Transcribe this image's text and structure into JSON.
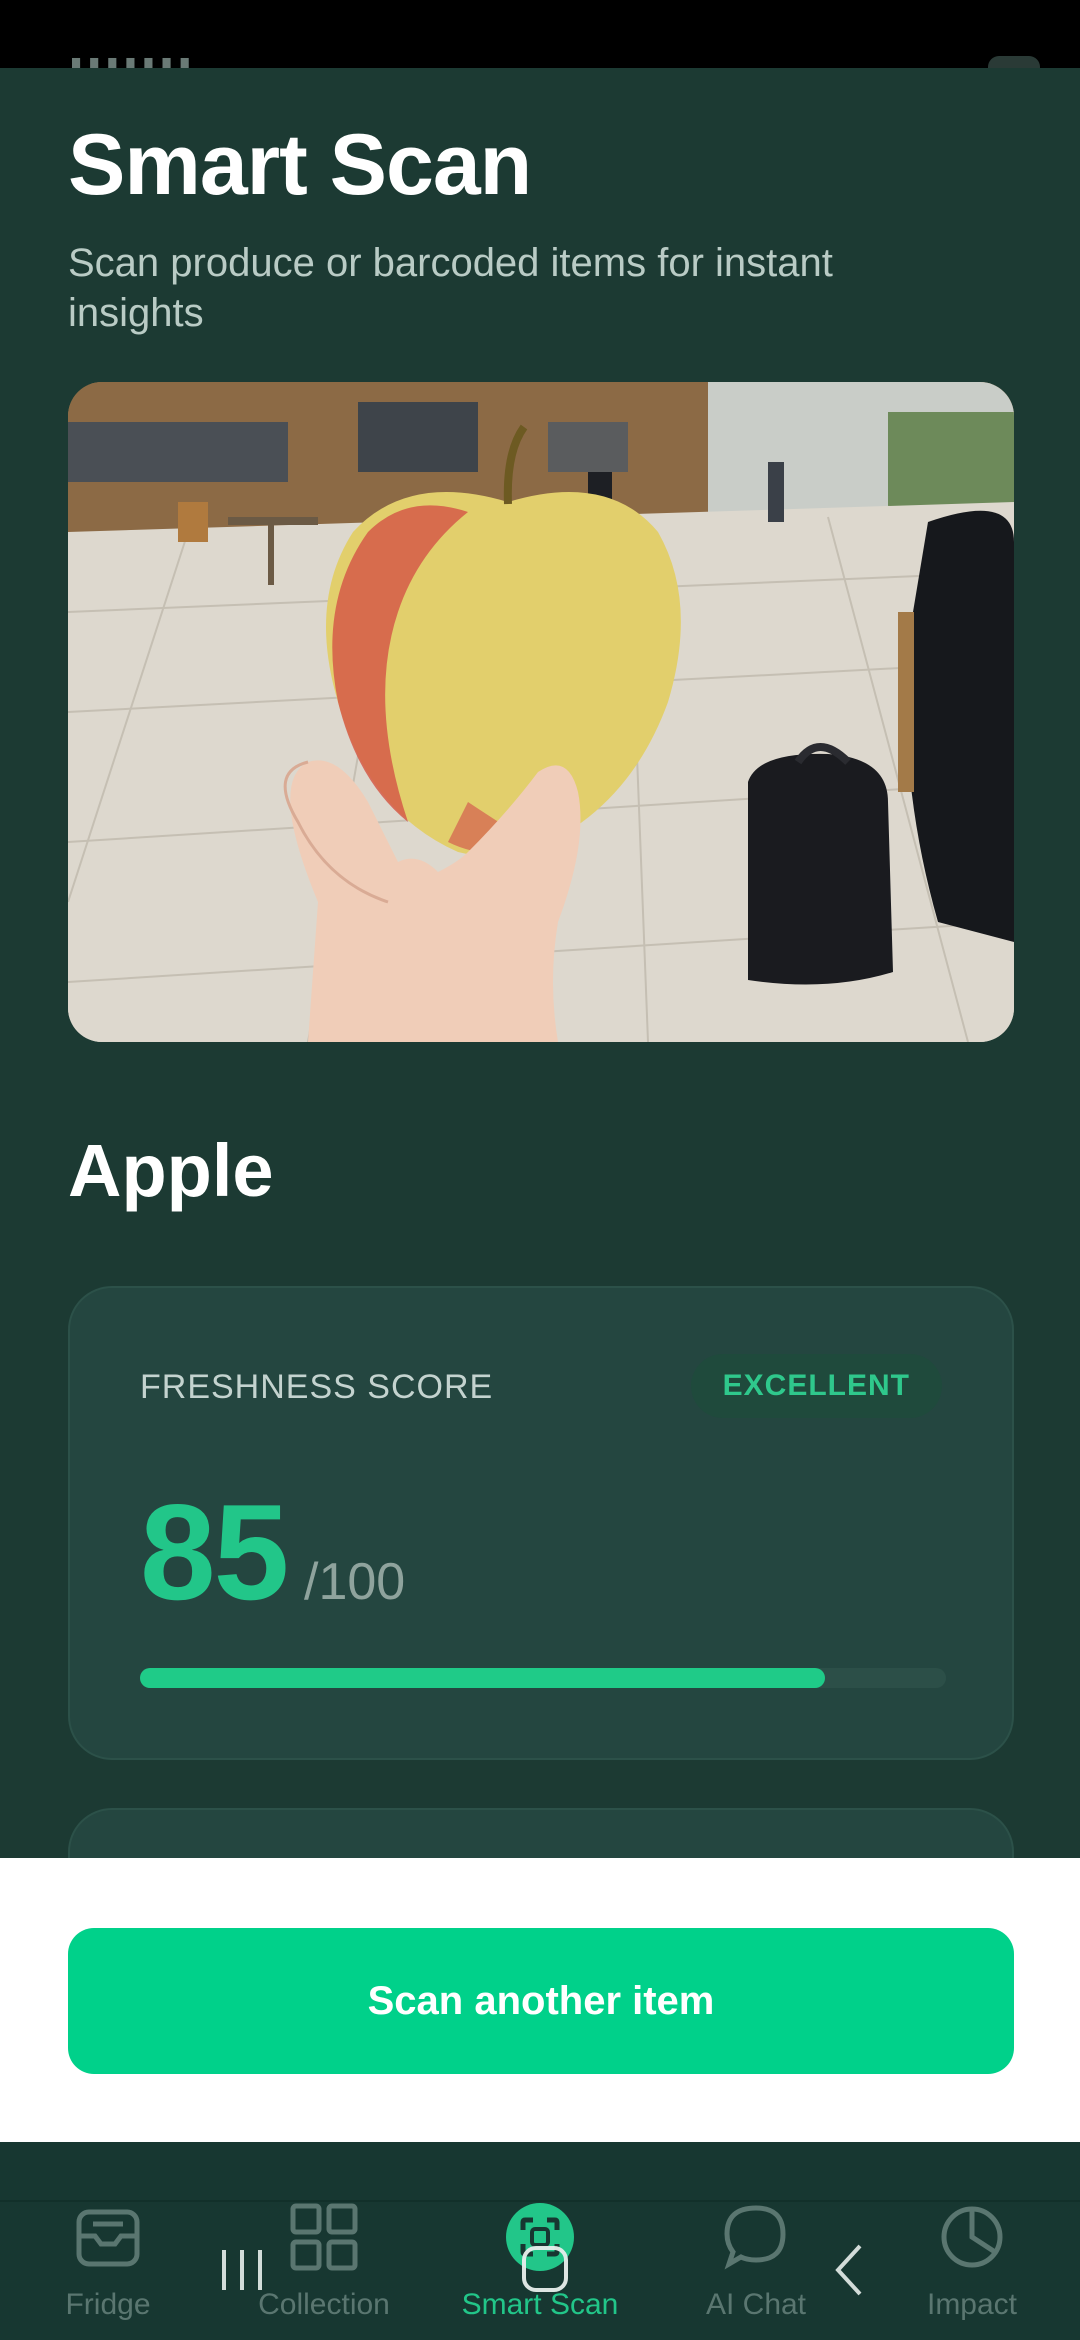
{
  "header": {
    "title": "Smart Scan",
    "subtitle": "Scan produce or barcoded items for instant insights"
  },
  "scan_result": {
    "item_name": "Apple",
    "freshness": {
      "label": "FRESHNESS SCORE",
      "badge": "EXCELLENT",
      "score": "85",
      "max": "/100",
      "fraction": 0.85
    }
  },
  "actions": {
    "scan_another_label": "Scan another item"
  },
  "bottom_nav": {
    "items": [
      {
        "label": "Fridge",
        "icon": "fridge-tray-icon"
      },
      {
        "label": "Collection",
        "icon": "grid-icon"
      },
      {
        "label": "Smart Scan",
        "icon": "scan-icon",
        "active": true
      },
      {
        "label": "AI Chat",
        "icon": "chat-bubble-icon"
      },
      {
        "label": "Impact",
        "icon": "pie-chart-icon"
      }
    ]
  },
  "colors": {
    "background": "#1c3a33",
    "accent": "#22c689",
    "button": "#00d18a"
  }
}
